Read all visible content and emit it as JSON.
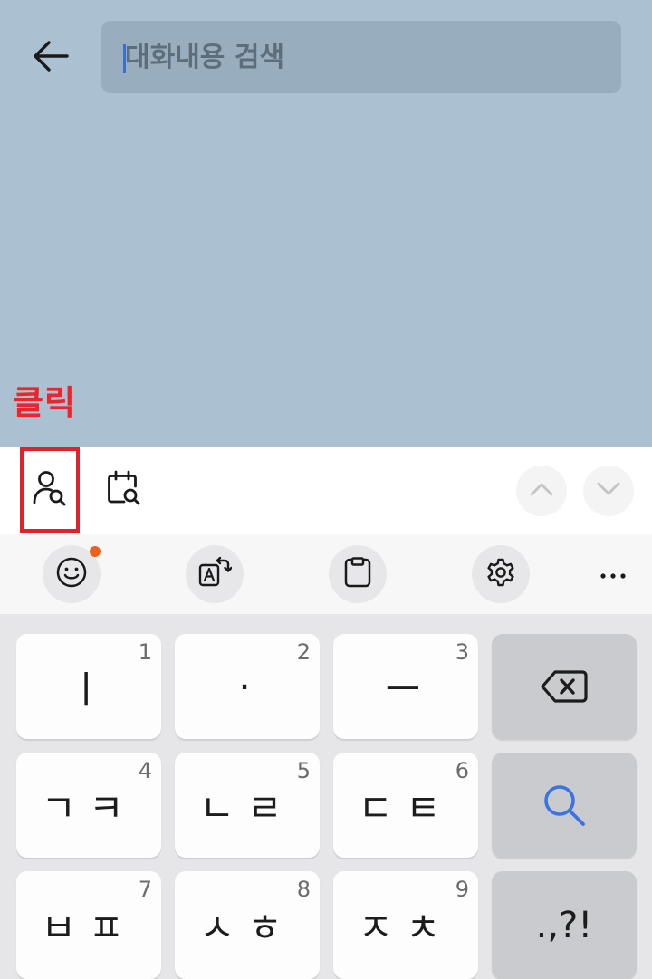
{
  "header": {
    "back_icon": "arrow-left-icon",
    "search": {
      "placeholder": "대화내용 검색",
      "value": ""
    }
  },
  "annotation": {
    "text": "클릭",
    "color": "#e8262c"
  },
  "filter_bar": {
    "items": [
      {
        "icon": "member-search-icon",
        "highlighted": true
      },
      {
        "icon": "date-search-icon",
        "highlighted": false
      }
    ],
    "navigation": [
      {
        "icon": "chevron-up-icon"
      },
      {
        "icon": "chevron-down-icon"
      }
    ]
  },
  "keyboard_toolbar": {
    "items": [
      {
        "icon": "emoji-icon",
        "notification": true,
        "notification_color": "#f0601e"
      },
      {
        "icon": "translate-icon"
      },
      {
        "icon": "clipboard-icon"
      },
      {
        "icon": "settings-icon"
      },
      {
        "icon": "more-icon"
      }
    ]
  },
  "keyboard": {
    "rows": [
      [
        {
          "label": "ㅣ",
          "number": "1"
        },
        {
          "label": "·",
          "number": "2"
        },
        {
          "label": "ㅡ",
          "number": "3"
        },
        {
          "icon": "backspace-icon"
        }
      ],
      [
        {
          "label": "ㄱㅋ",
          "number": "4"
        },
        {
          "label": "ㄴㄹ",
          "number": "5"
        },
        {
          "label": "ㄷㅌ",
          "number": "6"
        },
        {
          "icon": "search-icon"
        }
      ],
      [
        {
          "label": "ㅂㅍ",
          "number": "7"
        },
        {
          "label": "ㅅㅎ",
          "number": "8"
        },
        {
          "label": "ㅈㅊ",
          "number": "9"
        },
        {
          "label": ".,?!"
        }
      ]
    ]
  },
  "colors": {
    "chat_background": "#abc1d1",
    "search_box": "#98aebf",
    "highlight_box": "#e02329",
    "search_key_icon": "#3b74e0"
  }
}
